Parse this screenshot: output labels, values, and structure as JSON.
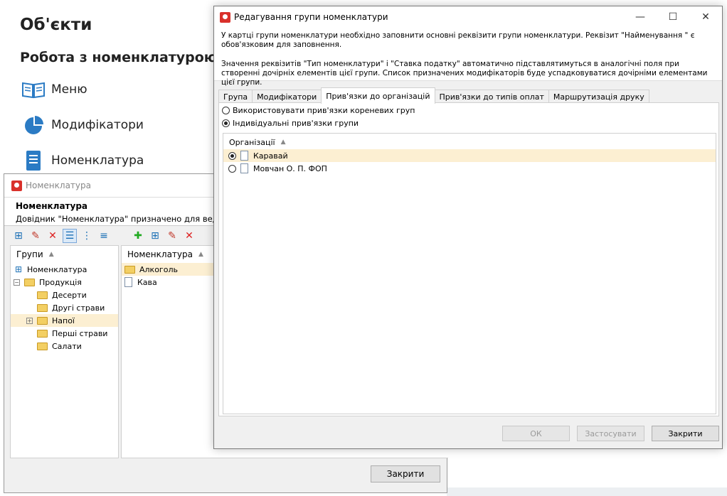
{
  "background": {
    "title": "Об'єкти",
    "subtitle": "Робота з номенклатурою",
    "items": [
      {
        "label": "Меню",
        "icon": "book-icon"
      },
      {
        "label": "Модифікатори",
        "icon": "pie-icon"
      },
      {
        "label": "Номенклатура",
        "icon": "document-icon"
      }
    ]
  },
  "nomenclature_window": {
    "title": "Номенклатура",
    "header_title": "Номенклатура",
    "header_desc": "Довідник \"Номенклатура\" призначено для ведення та",
    "groups_column": "Групи",
    "items_column": "Номенклатура",
    "tree": [
      {
        "label": "Номенклатура",
        "level": 0,
        "type": "root"
      },
      {
        "label": "Продукція",
        "level": 0,
        "type": "folder",
        "expander": "−"
      },
      {
        "label": "Десерти",
        "level": 1,
        "type": "folder"
      },
      {
        "label": "Другі страви",
        "level": 1,
        "type": "folder"
      },
      {
        "label": "Напої",
        "level": 1,
        "type": "folder",
        "expander": "+",
        "selected": true
      },
      {
        "label": "Перші страви",
        "level": 1,
        "type": "folder"
      },
      {
        "label": "Салати",
        "level": 1,
        "type": "folder"
      }
    ],
    "items": [
      {
        "label": "Алкоголь",
        "type": "folder",
        "selected": true
      },
      {
        "label": "Кава",
        "type": "doc"
      }
    ],
    "close_label": "Закрити"
  },
  "dialog": {
    "title": "Редагування групи номенклатури",
    "info_p1": "У картці групи номенклатури необхідно заповнити основні реквізити групи номенклатури. Реквізит \"Найменування \" є обов'язковим для заповнення.",
    "info_p2": "Значення реквізитів \"Тип номенклатури\" і \"Ставка податку\" автоматично підставлятимуться в аналогічні поля при створенні дочірніх елементів цієї групи. Список призначених модифікаторів буде успадковуватися дочірніми елементами цієї групи.",
    "tabs": [
      "Група",
      "Модифікатори",
      "Прив'язки до організацій",
      "Прив'язки до типів оплат",
      "Маршрутизація друку"
    ],
    "active_tab": 2,
    "radio_root": "Використовувати прив'язки кореневих груп",
    "radio_individual": "Індивідуальні прив'язки групи",
    "org_column": "Організації",
    "orgs": [
      {
        "label": "Каравай",
        "checked": true
      },
      {
        "label": "Мовчан О. П. ФОП",
        "checked": false
      }
    ],
    "ok_label": "ОК",
    "apply_label": "Застосувати",
    "close_label": "Закрити"
  }
}
